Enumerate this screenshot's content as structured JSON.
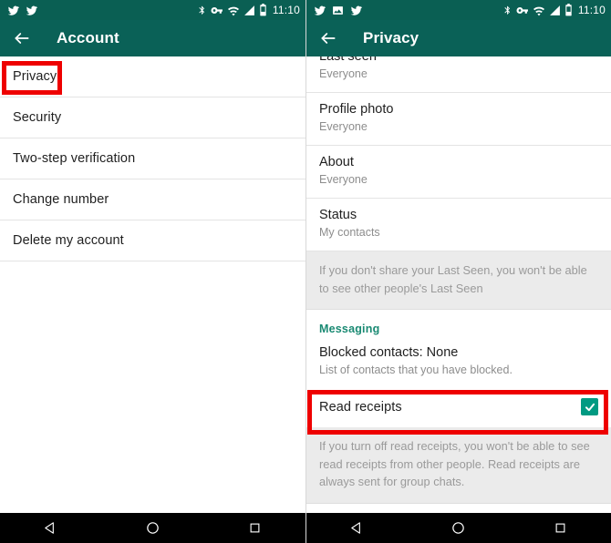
{
  "left_panel": {
    "status_bar": {
      "notification_icons": [
        "twitter-icon",
        "twitter-icon"
      ],
      "system_icons": [
        "bluetooth-icon",
        "vpn-key-icon",
        "wifi-icon",
        "signal-icon",
        "battery-icon"
      ],
      "time": "11:10"
    },
    "app_bar": {
      "back_label": "back-arrow",
      "title": "Account"
    },
    "items": [
      {
        "label": "Privacy"
      },
      {
        "label": "Security"
      },
      {
        "label": "Two-step verification"
      },
      {
        "label": "Change number"
      },
      {
        "label": "Delete my account"
      }
    ]
  },
  "right_panel": {
    "status_bar": {
      "notification_icons": [
        "twitter-icon",
        "image-icon",
        "twitter-icon"
      ],
      "system_icons": [
        "bluetooth-icon",
        "vpn-key-icon",
        "wifi-icon",
        "signal-icon",
        "battery-icon"
      ],
      "time": "11:10"
    },
    "app_bar": {
      "back_label": "back-arrow",
      "title": "Privacy"
    },
    "privacy_rows": [
      {
        "title": "Last seen",
        "value": "Everyone"
      },
      {
        "title": "Profile photo",
        "value": "Everyone"
      },
      {
        "title": "About",
        "value": "Everyone"
      },
      {
        "title": "Status",
        "value": "My contacts"
      }
    ],
    "last_seen_note": "If you don't share your Last Seen, you won't be able to see other people's Last Seen",
    "messaging_section": {
      "header": "Messaging",
      "blocked_contacts": {
        "title": "Blocked contacts: None",
        "subtitle": "List of contacts that you have blocked."
      },
      "read_receipts": {
        "label": "Read receipts",
        "checked": true
      },
      "read_receipts_note": "If you turn off read receipts, you won't be able to see read receipts from other people. Read receipts are always sent for group chats."
    }
  },
  "nav_bar": {
    "buttons": [
      "back-triangle-icon",
      "home-circle-icon",
      "recents-square-icon"
    ]
  },
  "colors": {
    "app_bar": "#0a6157",
    "status_bar": "#0a5f53",
    "accent_teal": "#1a8a73",
    "checkbox": "#009a82",
    "annotation_red": "#ee0000",
    "info_background": "#ebebeb"
  }
}
